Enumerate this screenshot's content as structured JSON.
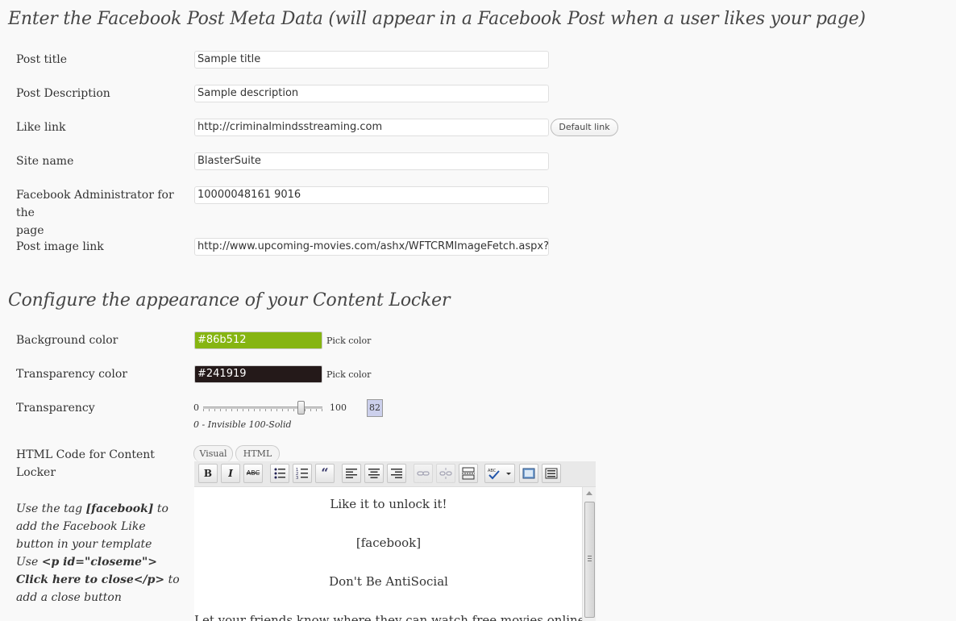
{
  "facebook_meta": {
    "heading": "Enter the Facebook Post Meta Data (will appear in a Facebook Post when a user likes your page)",
    "post_title": {
      "label": "Post title",
      "value": "Sample title"
    },
    "post_description": {
      "label": "Post Description",
      "value": "Sample description"
    },
    "like_link": {
      "label": "Like link",
      "value": "http://criminalmindsstreaming.com",
      "button": "Default link"
    },
    "site_name": {
      "label": "Site name",
      "value": "BlasterSuite"
    },
    "fb_admin": {
      "label_line1": "Facebook Administrator for the",
      "label_line2": "page",
      "value": "10000048161 9016"
    },
    "post_image": {
      "label": "Post image link",
      "value": "http://www.upcoming-movies.com/ashx/WFTCRMImageFetch.aspx?D"
    }
  },
  "appearance": {
    "heading": "Configure the appearance of your Content Locker",
    "background_color": {
      "label": "Background color",
      "value": "#86b512",
      "pick": "Pick color",
      "swatch": "#86b512"
    },
    "transparency_color": {
      "label": "Transparency color",
      "value": "#241919",
      "pick": "Pick color",
      "swatch": "#241919"
    },
    "transparency": {
      "label": "Transparency",
      "min": "0",
      "max": "100",
      "value": 82,
      "value_text": "82",
      "hint": "0 - Invisible 100-Solid"
    },
    "html_code": {
      "label_line1": "HTML Code for Content",
      "label_line2": "Locker",
      "tab_visual": "Visual",
      "tab_html": "HTML",
      "help_use": "Use the tag",
      "help_tag": "[facebook]",
      "help_rest": "to add the Facebook Like button in your template",
      "help_use2": "Use",
      "help_code": "<p id=\"closeme\"> Click here to close</p>",
      "help_rest2": "to add a close button",
      "toolbar": {
        "bold": "B",
        "italic": "I",
        "strike": "ABC",
        "quote": "“"
      },
      "editor_lines": [
        "Like it to unlock it!",
        "[facebook]",
        "Don't Be AntiSocial",
        "Let your friends know where they can watch free movies online"
      ]
    }
  },
  "icons": [
    "bold-icon",
    "italic-icon",
    "strikethrough-icon",
    "bullet-list-icon",
    "numbered-list-icon",
    "blockquote-icon",
    "align-left-icon",
    "align-center-icon",
    "align-right-icon",
    "link-icon",
    "unlink-icon",
    "more-tag-icon",
    "spellcheck-icon",
    "fullscreen-icon",
    "kitchen-sink-icon"
  ]
}
